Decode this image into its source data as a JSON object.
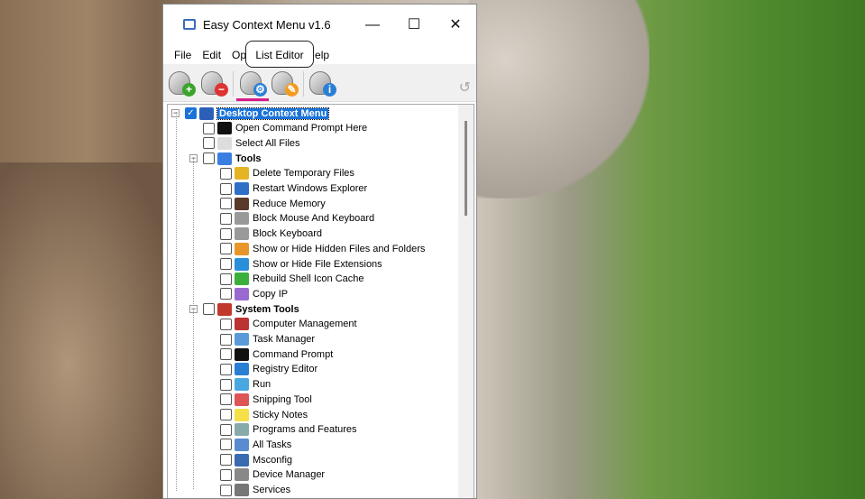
{
  "window": {
    "title": "Easy Context Menu v1.6",
    "minimize": "—",
    "maximize": "☐",
    "close": "✕"
  },
  "menu": [
    "File",
    "Edit",
    "Options",
    "Help"
  ],
  "tooltip": "List Editor",
  "toolbar": {
    "accent": "#d81b8a",
    "buttons": [
      {
        "name": "add",
        "badge": "+",
        "color": "#3aa52c"
      },
      {
        "name": "remove",
        "badge": "−",
        "color": "#d33"
      },
      {
        "name": "list-editor",
        "badge": "⚙",
        "color": "#2a7fd4"
      },
      {
        "name": "cleaner",
        "badge": "✎",
        "color": "#f39b1f"
      },
      {
        "name": "about",
        "badge": "i",
        "color": "#2a7fd4"
      }
    ],
    "undo": "↺"
  },
  "tree": [
    {
      "label": "Desktop Context Menu",
      "level": 0,
      "group": true,
      "checked": true,
      "selected": true,
      "color": "#2b5fb8"
    },
    {
      "label": "Open Command Prompt Here",
      "level": 1,
      "color": "#111"
    },
    {
      "label": "Select All Files",
      "level": 1,
      "color": "#ddd"
    },
    {
      "label": "Tools",
      "level": 1,
      "group": true,
      "color": "#3a7fe0"
    },
    {
      "label": "Delete Temporary Files",
      "level": 2,
      "color": "#e6b422"
    },
    {
      "label": "Restart Windows Explorer",
      "level": 2,
      "color": "#2f6fc7"
    },
    {
      "label": "Reduce Memory",
      "level": 2,
      "color": "#5a3a2a"
    },
    {
      "label": "Block Mouse And Keyboard",
      "level": 2,
      "color": "#999"
    },
    {
      "label": "Block Keyboard",
      "level": 2,
      "color": "#999"
    },
    {
      "label": "Show or Hide Hidden Files and Folders",
      "level": 2,
      "color": "#e8962a"
    },
    {
      "label": "Show or Hide File Extensions",
      "level": 2,
      "color": "#2a8fd8"
    },
    {
      "label": "Rebuild Shell Icon Cache",
      "level": 2,
      "color": "#3ab03a"
    },
    {
      "label": "Copy IP",
      "level": 2,
      "color": "#9a6ad0"
    },
    {
      "label": "System Tools",
      "level": 1,
      "group": true,
      "color": "#c0392b"
    },
    {
      "label": "Computer Management",
      "level": 2,
      "color": "#b33"
    },
    {
      "label": "Task Manager",
      "level": 2,
      "color": "#5a9ad8"
    },
    {
      "label": "Command Prompt",
      "level": 2,
      "color": "#111"
    },
    {
      "label": "Registry Editor",
      "level": 2,
      "color": "#2a7fd4"
    },
    {
      "label": "Run",
      "level": 2,
      "color": "#4aa8e0"
    },
    {
      "label": "Snipping Tool",
      "level": 2,
      "color": "#d55"
    },
    {
      "label": "Sticky Notes",
      "level": 2,
      "color": "#f5e04a"
    },
    {
      "label": "Programs and Features",
      "level": 2,
      "color": "#8aa"
    },
    {
      "label": "All Tasks",
      "level": 2,
      "color": "#5a8ad0"
    },
    {
      "label": "Msconfig",
      "level": 2,
      "color": "#3a6ab0"
    },
    {
      "label": "Device Manager",
      "level": 2,
      "color": "#888"
    },
    {
      "label": "Services",
      "level": 2,
      "color": "#777"
    }
  ]
}
